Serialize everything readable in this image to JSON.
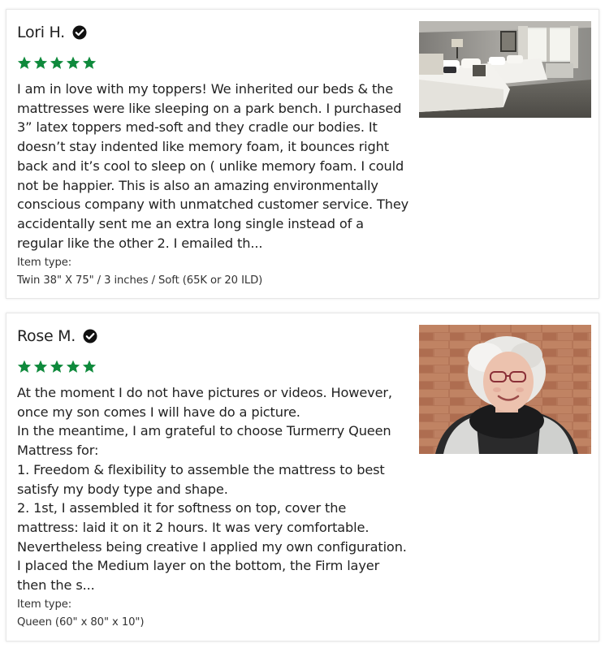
{
  "reviews": [
    {
      "reviewer_name": "Lori H.",
      "verified_icon": "check-circle-icon",
      "rating": 5,
      "rating_max": 5,
      "star_color": "#0f8a3c",
      "body": "I am in love with my toppers!  We inherited our beds & the mattresses were like sleeping on a park bench. I purchased 3” latex toppers med-soft and they cradle our bodies. It doesn’t stay indented like memory foam, it bounces right back and it’s cool to sleep on ( unlike memory foam. I could not be happier. This is also an amazing environmentally conscious company with unmatched customer service. They accidentally sent me an extra long single instead  of a regular like the other 2. I emailed th...",
      "item_type_label": "Item type:",
      "item_type_value": "Twin 38\" X 75\" / 3 inches / Soft (65K or 20 ILD)",
      "photo": "bedroom-photo"
    },
    {
      "reviewer_name": "Rose M.",
      "verified_icon": "check-circle-icon",
      "rating": 5,
      "rating_max": 5,
      "star_color": "#0f8a3c",
      "body": "At the moment I do not have pictures or videos. However, once my son comes I will have do a picture.\nIn the meantime, I am grateful to choose Turmerry Queen Mattress for:\n1. Freedom & flexibility to assemble the mattress to best satisfy my body type and shape.\n2. 1st, I assembled it for softness on top, cover the mattress: laid it on it 2 hours. It was very comfortable. Nevertheless being creative I applied my own configuration. I placed the Medium layer on the bottom, the Firm layer then the s...",
      "item_type_label": "Item type:",
      "item_type_value": "Queen (60\" x 80\" x 10\")",
      "photo": "reviewer-portrait-photo"
    }
  ]
}
